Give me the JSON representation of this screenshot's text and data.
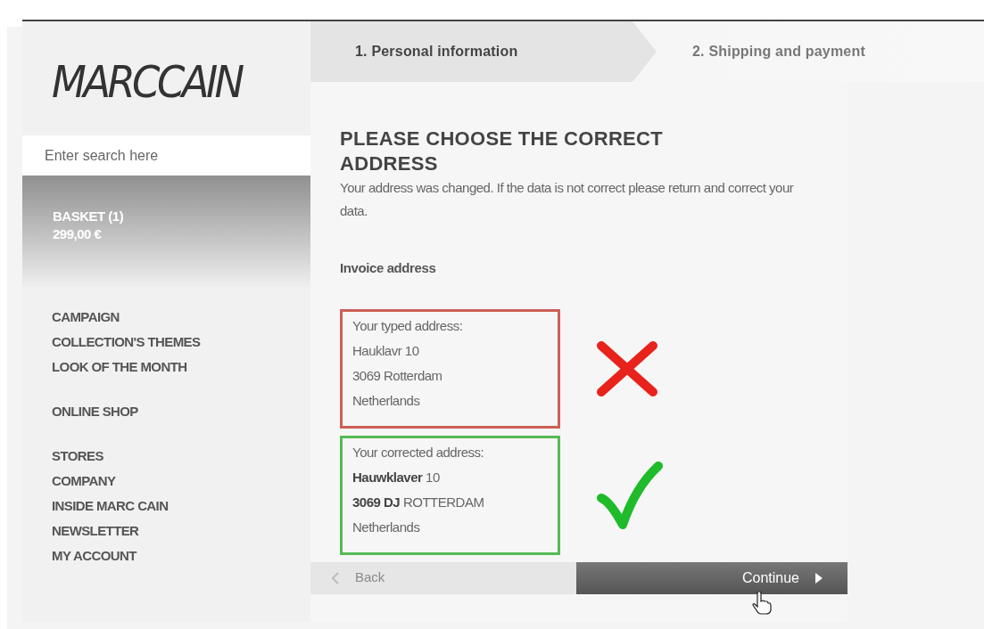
{
  "logo": "MARCCAIN",
  "search": {
    "placeholder": "Enter search here"
  },
  "basket": {
    "label": "BASKET (1)",
    "total": "299,00 €"
  },
  "nav_groups": [
    {
      "items": [
        "CAMPAIGN",
        "COLLECTION'S THEMES",
        "LOOK OF THE MONTH"
      ]
    },
    {
      "items": [
        "ONLINE SHOP"
      ]
    },
    {
      "items": [
        "STORES",
        "COMPANY",
        "INSIDE MARC CAIN",
        "NEWSLETTER",
        "MY ACCOUNT"
      ]
    }
  ],
  "steps": [
    {
      "label": "1. Personal information",
      "selected": true
    },
    {
      "label": "2. Shipping and payment",
      "selected": false
    }
  ],
  "heading": "PLEASE CHOOSE THE CORRECT ADDRESS",
  "intro": "Your address was changed. If the data is not correct please return and correct your data.",
  "section_label": "Invoice address",
  "addresses": [
    {
      "kind": "typed",
      "lines": [
        "Your typed address:",
        "Hauklavr 10",
        "3069 Rotterdam",
        "Netherlands"
      ]
    },
    {
      "kind": "corrected",
      "lines": [
        "Your corrected address:",
        "**Hauwklaver** 10",
        "**3069 DJ** ROTTERDAM",
        "Netherlands"
      ]
    }
  ],
  "back_button": {
    "label": "Back",
    "disabled": true
  },
  "continue_button": {
    "label": "Continue"
  }
}
